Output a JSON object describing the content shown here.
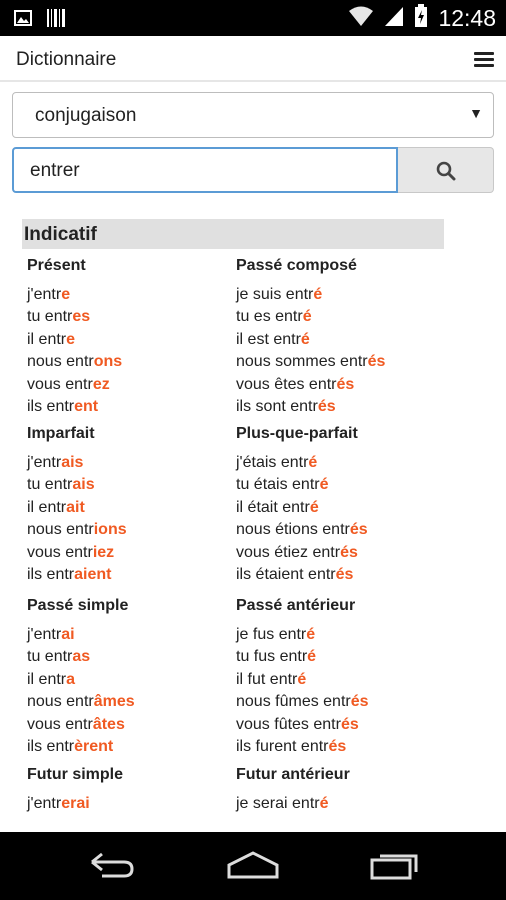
{
  "status_bar": {
    "time": "12:48"
  },
  "app_bar": {
    "title": "Dictionnaire"
  },
  "select": {
    "value": "conjugaison"
  },
  "search": {
    "value": "entrer"
  },
  "mood": {
    "title": "Indicatif"
  },
  "tenses": [
    {
      "title": "Présent",
      "forms": [
        [
          "j'entr",
          "e"
        ],
        [
          "tu entr",
          "es"
        ],
        [
          "il entr",
          "e"
        ],
        [
          "nous entr",
          "ons"
        ],
        [
          "vous entr",
          "ez"
        ],
        [
          "ils entr",
          "ent"
        ]
      ]
    },
    {
      "title": "Passé composé",
      "forms": [
        [
          "je suis entr",
          "é"
        ],
        [
          "tu es entr",
          "é"
        ],
        [
          "il est entr",
          "é"
        ],
        [
          "nous sommes entr",
          "és"
        ],
        [
          "vous êtes entr",
          "és"
        ],
        [
          "ils sont entr",
          "és"
        ]
      ]
    },
    {
      "title": "Imparfait",
      "forms": [
        [
          "j'entr",
          "ais"
        ],
        [
          "tu entr",
          "ais"
        ],
        [
          "il entr",
          "ait"
        ],
        [
          "nous entr",
          "ions"
        ],
        [
          "vous entr",
          "iez"
        ],
        [
          "ils entr",
          "aient"
        ]
      ]
    },
    {
      "title": "Plus-que-parfait",
      "forms": [
        [
          "j'étais entr",
          "é"
        ],
        [
          "tu étais entr",
          "é"
        ],
        [
          "il était entr",
          "é"
        ],
        [
          "nous étions entr",
          "és"
        ],
        [
          "vous étiez entr",
          "és"
        ],
        [
          "ils étaient entr",
          "és"
        ]
      ]
    },
    {
      "title": "Passé simple",
      "forms": [
        [
          "j'entr",
          "ai"
        ],
        [
          "tu entr",
          "as"
        ],
        [
          "il entr",
          "a"
        ],
        [
          "nous entr",
          "âmes"
        ],
        [
          "vous entr",
          "âtes"
        ],
        [
          "ils entr",
          "èrent"
        ]
      ]
    },
    {
      "title": "Passé antérieur",
      "forms": [
        [
          "je fus entr",
          "é"
        ],
        [
          "tu fus entr",
          "é"
        ],
        [
          "il fut entr",
          "é"
        ],
        [
          "nous fûmes entr",
          "és"
        ],
        [
          "vous fûtes entr",
          "és"
        ],
        [
          "ils furent entr",
          "és"
        ]
      ]
    },
    {
      "title": "Futur simple",
      "forms": [
        [
          "j'entr",
          "erai"
        ]
      ]
    },
    {
      "title": "Futur antérieur",
      "forms": [
        [
          "je serai entr",
          "é"
        ]
      ]
    }
  ],
  "colors": {
    "ending": "#f05a22",
    "focus_border": "#5b9bd5",
    "section_bg": "#e0e0e0"
  },
  "icons": [
    "image-icon",
    "barcode-icon",
    "wifi-icon",
    "signal-icon",
    "battery-charging-icon",
    "menu-icon",
    "search-icon",
    "back-icon",
    "home-icon",
    "recents-icon"
  ]
}
